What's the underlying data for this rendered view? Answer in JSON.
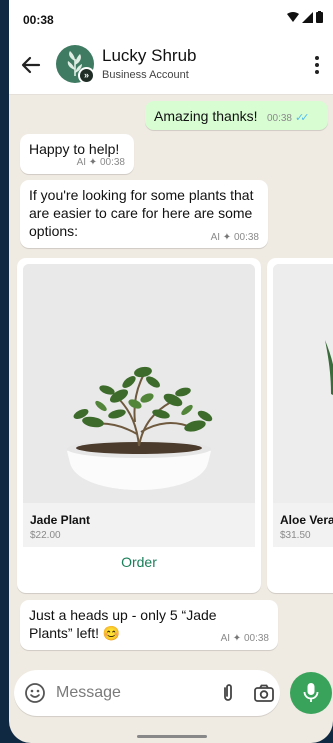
{
  "status_bar": {
    "time": "00:38"
  },
  "header": {
    "name": "Lucky Shrub",
    "subtitle": "Business Account"
  },
  "messages": [
    {
      "text": "Amazing thanks!",
      "time": "00:38"
    },
    {
      "text": "Happy to help!",
      "ai": "AI",
      "time": "00:38"
    },
    {
      "text": "If you're looking for some plants that are easier to care for here are some options:",
      "ai": "AI",
      "time": "00:38"
    },
    {
      "text": "Just a heads up - only 5 “Jade Plants” left! 😊",
      "ai": "AI",
      "time": "00:38"
    }
  ],
  "products": [
    {
      "name": "Jade Plant",
      "price": "$22.00",
      "action": "Order"
    },
    {
      "name": "Aloe Vera",
      "price": "$31.50"
    }
  ],
  "composer": {
    "placeholder": "Message"
  },
  "colors": {
    "accent": "#3aa35b",
    "outgoing_bubble": "#d9fdd3",
    "chat_background": "#efeae2",
    "order_link": "#1a7f5a"
  },
  "icons": [
    "back-arrow-icon",
    "more-options-icon",
    "ai-sparkle-icon",
    "read-ticks-icon",
    "emoji-icon",
    "attach-icon",
    "camera-icon",
    "mic-icon"
  ]
}
